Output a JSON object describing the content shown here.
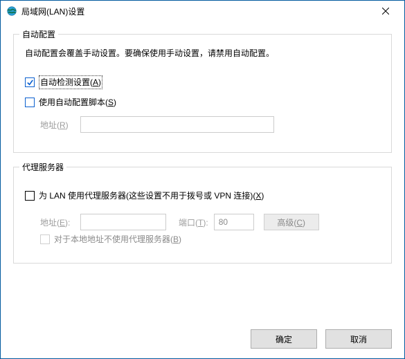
{
  "titlebar": {
    "title": "局域网(LAN)设置"
  },
  "auto_config": {
    "legend": "自动配置",
    "description": "自动配置会覆盖手动设置。要确保使用手动设置，请禁用自动配置。",
    "auto_detect": {
      "label": "自动检测设置(A)",
      "checked": true
    },
    "use_script": {
      "label": "使用自动配置脚本(S)",
      "checked": false
    },
    "address_label": "地址(R)",
    "address_value": ""
  },
  "proxy": {
    "legend": "代理服务器",
    "use_proxy": {
      "label": "为 LAN 使用代理服务器(这些设置不用于拨号或 VPN 连接)(X)",
      "checked": false
    },
    "address_label": "地址(E):",
    "address_value": "",
    "port_label": "端口(T):",
    "port_value": "80",
    "advanced_label": "高级(C)",
    "bypass_local": {
      "label": "对于本地地址不使用代理服务器(B)",
      "checked": false,
      "enabled": false
    }
  },
  "footer": {
    "ok": "确定",
    "cancel": "取消"
  }
}
